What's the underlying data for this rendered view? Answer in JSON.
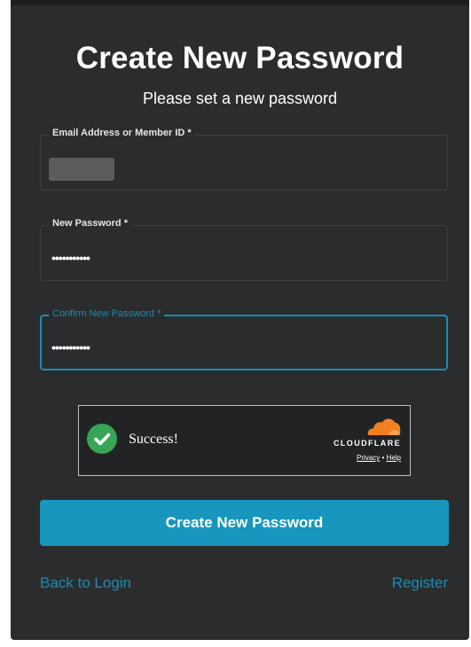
{
  "header": {
    "title": "Create New Password",
    "subtitle": "Please set a new password"
  },
  "form": {
    "email": {
      "label": "Email Address or Member ID *",
      "value": ""
    },
    "new_password": {
      "label": "New Password *",
      "value": "•••••••••••"
    },
    "confirm_password": {
      "label": "Confirm New Password *",
      "value": "•••••••••••"
    }
  },
  "captcha": {
    "status": "Success!",
    "brand": "CLOUDFLARE",
    "privacy": "Privacy",
    "separator": "•",
    "help": "Help",
    "icon": "checkmark-icon",
    "success_color": "#37a556",
    "logo_color": "#f38020"
  },
  "actions": {
    "submit_label": "Create New Password",
    "back_link": "Back to Login",
    "register_link": "Register"
  },
  "colors": {
    "accent": "#1896bd",
    "background": "#2b2c2d"
  }
}
